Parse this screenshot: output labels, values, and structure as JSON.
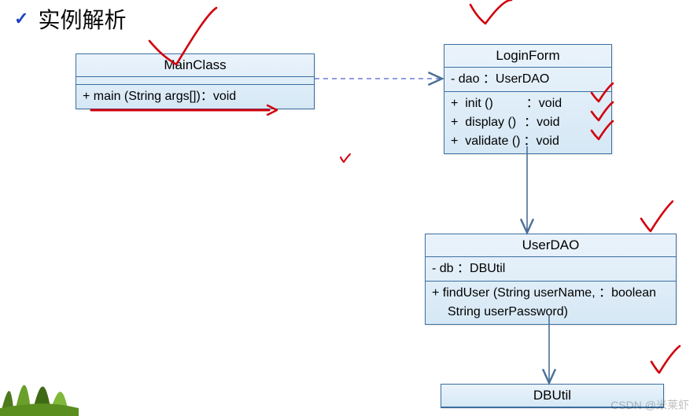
{
  "heading": "实例解析",
  "watermark": "CSDN @米莱虾",
  "mainClass": {
    "name": "MainClass",
    "attrs": "",
    "op1": "+  main (String args[])：void"
  },
  "loginForm": {
    "name": "LoginForm",
    "attr1": "-  dao ：UserDAO",
    "op1_l": "+  init ()",
    "op1_r": "：void",
    "op2_l": "+  display ()",
    "op2_r": "：void",
    "op3_l": "+  validate ()",
    "op3_r": "：void"
  },
  "userDAO": {
    "name": "UserDAO",
    "attr1": "-  db ：DBUtil",
    "op1": "+  findUser (String userName,   ：boolean",
    "op1b": "   String userPassword)"
  },
  "dbUtil": {
    "name": "DBUtil"
  },
  "chart_data": {
    "type": "uml_class_diagram",
    "classes": [
      {
        "name": "MainClass",
        "attributes": [],
        "operations": [
          {
            "vis": "+",
            "sig": "main(String args[])",
            "ret": "void"
          }
        ]
      },
      {
        "name": "LoginForm",
        "attributes": [
          {
            "vis": "-",
            "name": "dao",
            "type": "UserDAO"
          }
        ],
        "operations": [
          {
            "vis": "+",
            "sig": "init()",
            "ret": "void"
          },
          {
            "vis": "+",
            "sig": "display()",
            "ret": "void"
          },
          {
            "vis": "+",
            "sig": "validate()",
            "ret": "void"
          }
        ]
      },
      {
        "name": "UserDAO",
        "attributes": [
          {
            "vis": "-",
            "name": "db",
            "type": "DBUtil"
          }
        ],
        "operations": [
          {
            "vis": "+",
            "sig": "findUser(String userName, String userPassword)",
            "ret": "boolean"
          }
        ]
      },
      {
        "name": "DBUtil",
        "attributes": [],
        "operations": []
      }
    ],
    "relationships": [
      {
        "from": "MainClass",
        "to": "LoginForm",
        "type": "dependency"
      },
      {
        "from": "LoginForm",
        "to": "UserDAO",
        "type": "association"
      },
      {
        "from": "UserDAO",
        "to": "DBUtil",
        "type": "association"
      }
    ],
    "title": "实例解析",
    "annotations": "hand-drawn red check marks and strike-through on MainClass.main"
  }
}
